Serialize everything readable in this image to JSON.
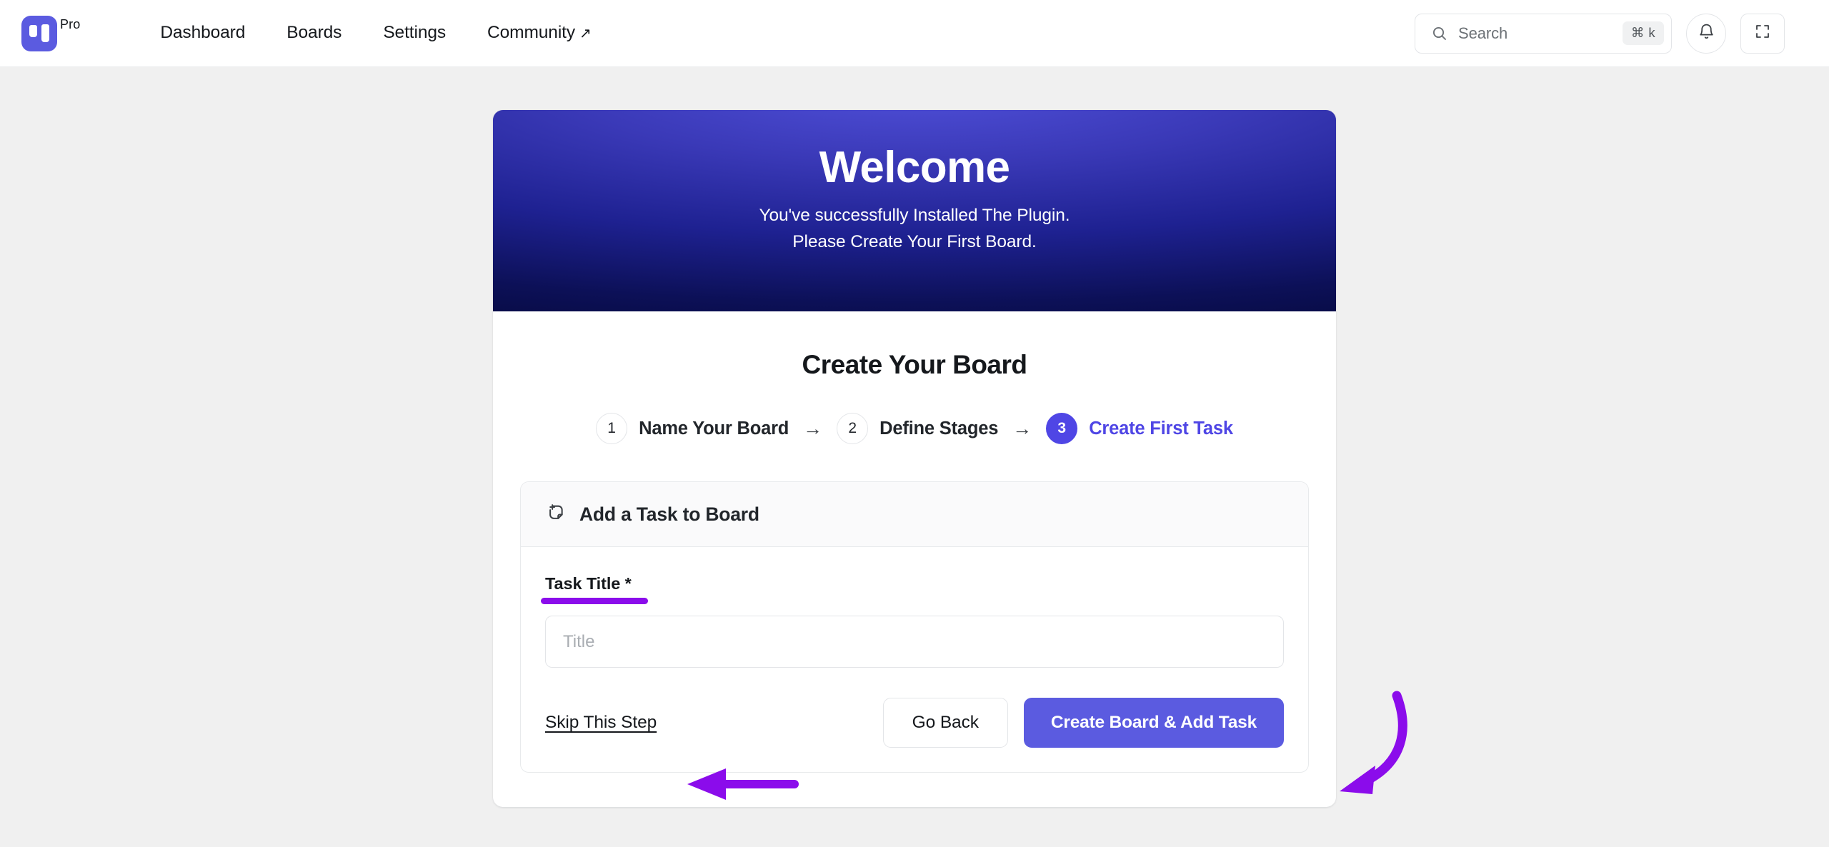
{
  "header": {
    "brand": {
      "tag": "Pro",
      "logo_icon": "board-logo-icon",
      "accent": "#5b5be0"
    },
    "nav": [
      {
        "label": "Dashboard",
        "external": false
      },
      {
        "label": "Boards",
        "external": false
      },
      {
        "label": "Settings",
        "external": false
      },
      {
        "label": "Community",
        "external": true,
        "external_glyph": "↗"
      }
    ],
    "search": {
      "placeholder": "Search",
      "value": "",
      "shortcut": "⌘ k",
      "icon": "search-icon"
    },
    "notifications_icon": "bell-icon",
    "fullscreen_icon": "expand-icon"
  },
  "hero": {
    "title": "Welcome",
    "line1": "You've successfully Installed The Plugin.",
    "line2": "Please Create Your First Board.",
    "gradient_from": "#5050da",
    "gradient_to": "#05083a"
  },
  "wizard": {
    "title": "Create Your Board",
    "arrow_glyph": "→",
    "steps": [
      {
        "number": "1",
        "label": "Name Your Board",
        "active": false
      },
      {
        "number": "2",
        "label": "Define Stages",
        "active": false
      },
      {
        "number": "3",
        "label": "Create First Task",
        "active": true
      }
    ],
    "active_color": "#4f46e5"
  },
  "task_panel": {
    "header_icon": "note-plus-icon",
    "header_title": "Add a Task to Board",
    "field": {
      "label": "Task Title *",
      "placeholder": "Title",
      "value": ""
    },
    "skip_label": "Skip This Step",
    "back_label": "Go Back",
    "submit_label": "Create Board & Add Task",
    "submit_color": "#5b5be0"
  },
  "annotations": {
    "color": "#8b0ceb",
    "label_underline": {
      "target": "Task Title *"
    },
    "arrow_to_skip": {
      "target": "Skip This Step",
      "direction": "left"
    },
    "curved_arrow_to_submit": {
      "target": "Create Board & Add Task",
      "direction": "down-left"
    }
  }
}
